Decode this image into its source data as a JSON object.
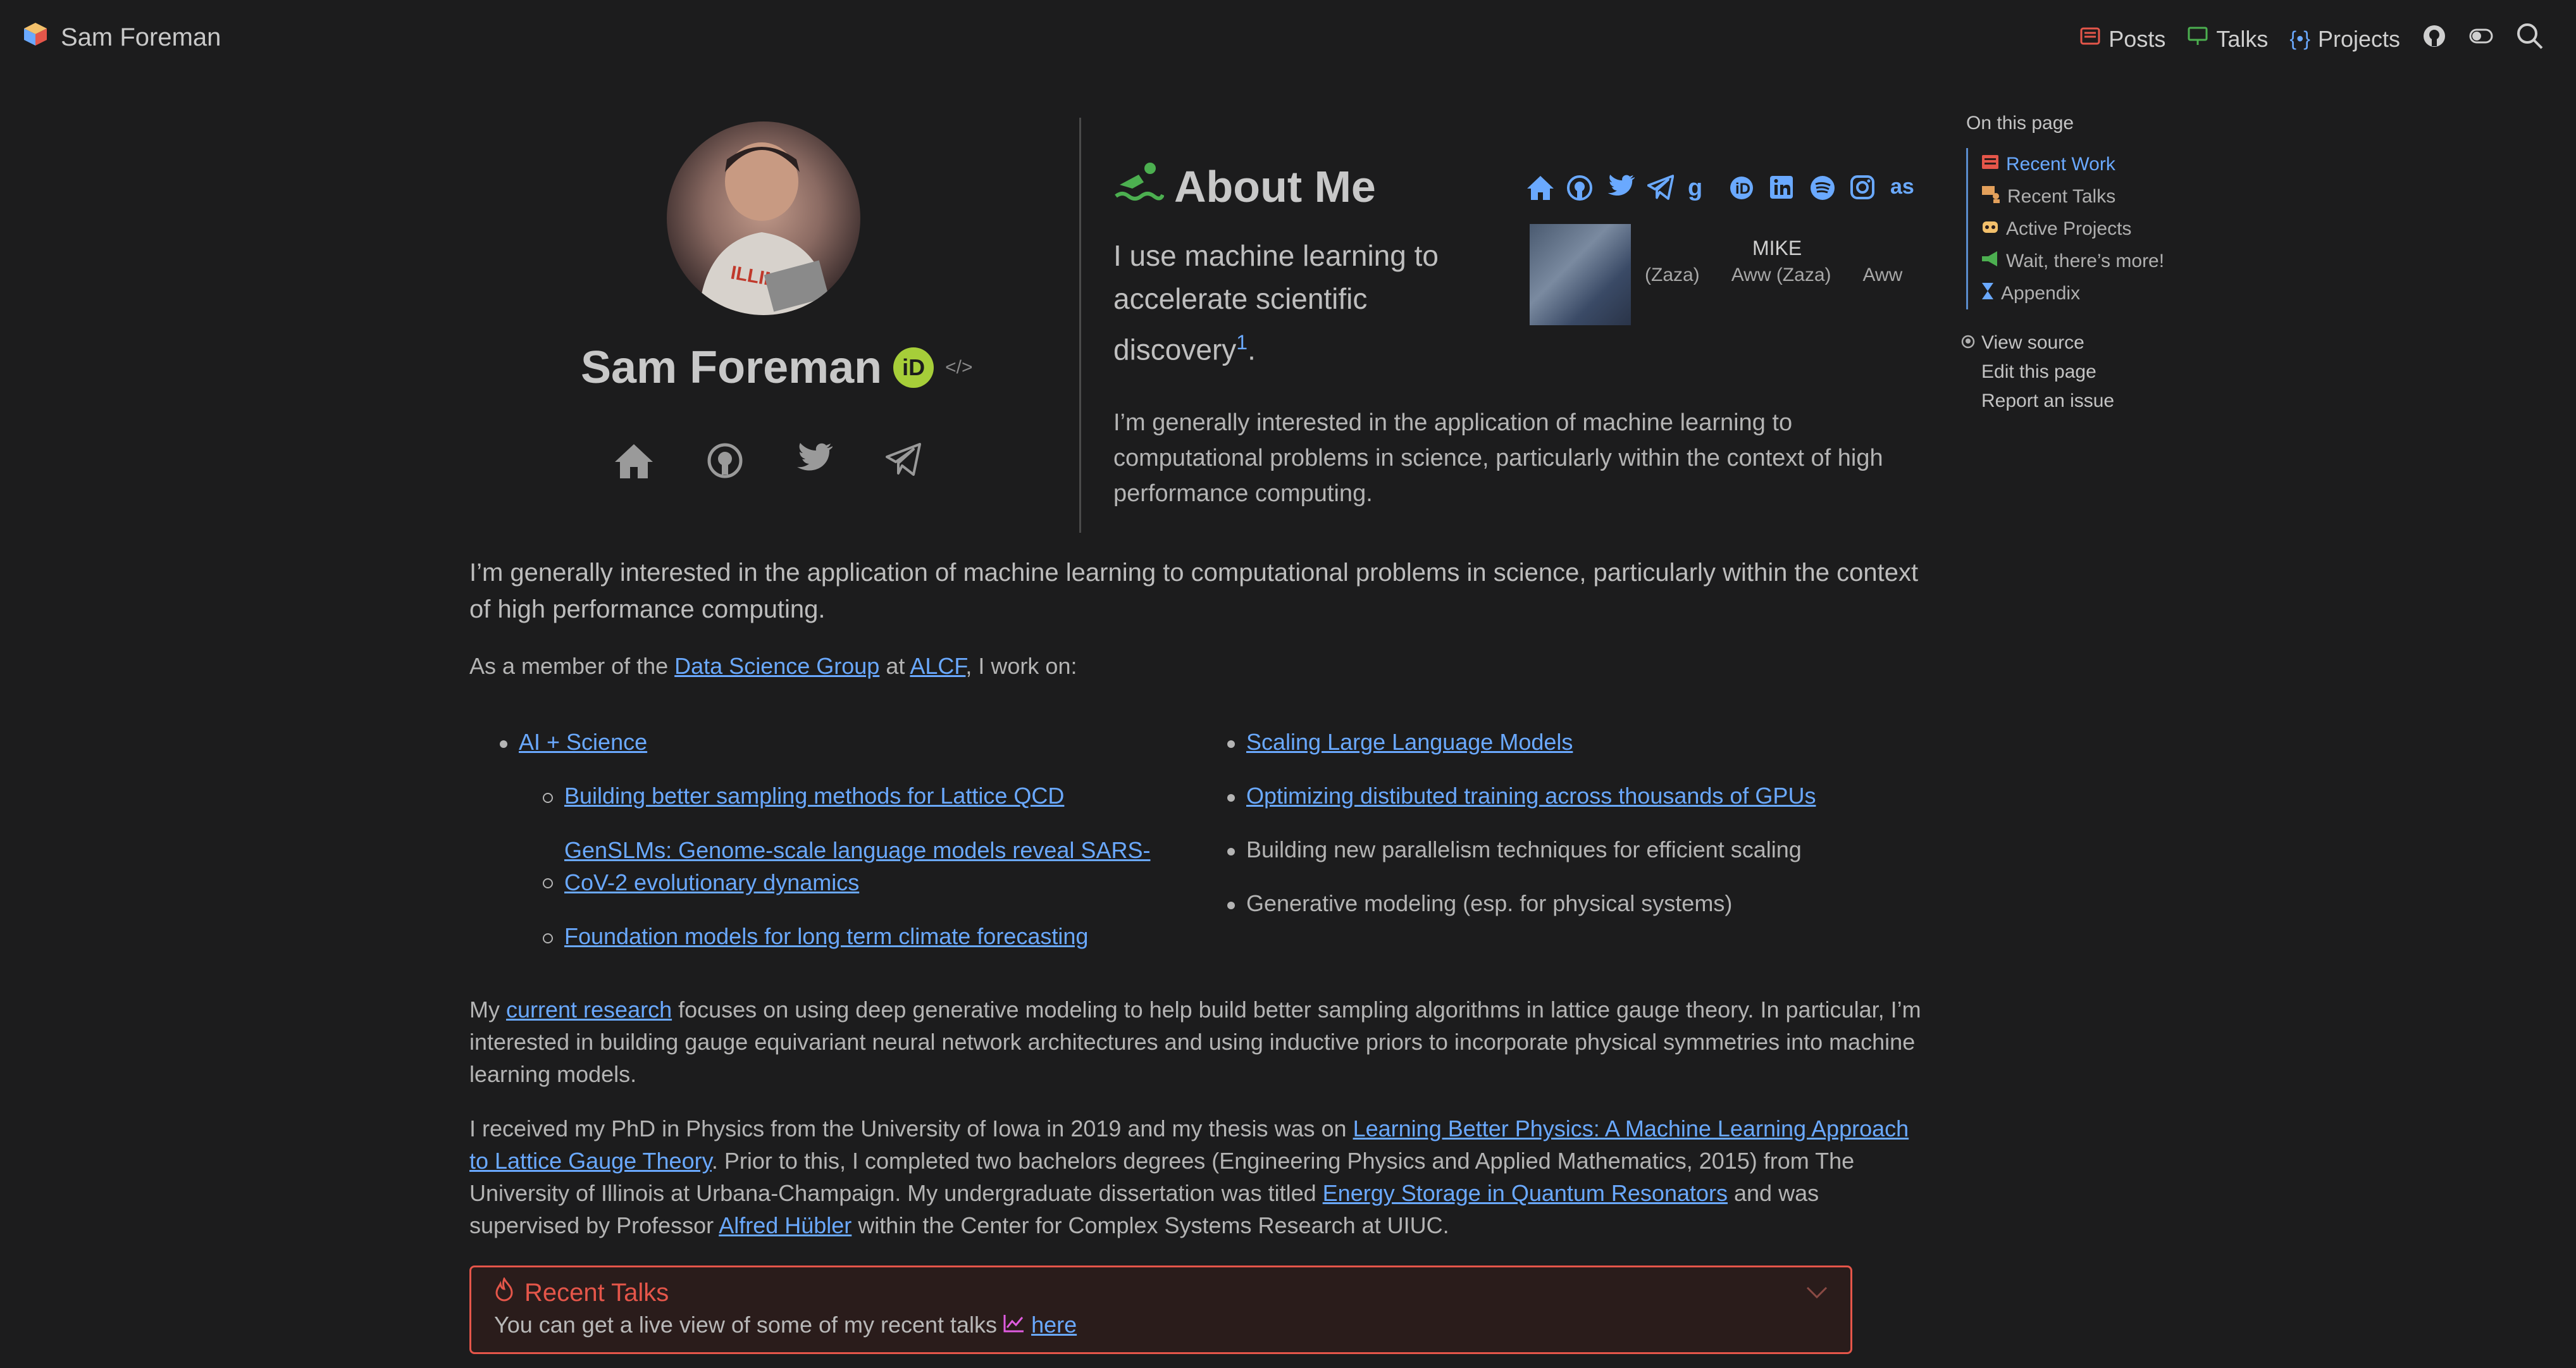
{
  "navbar": {
    "brand": "Sam Foreman",
    "links": [
      {
        "label": "Posts",
        "icon": "newspaper-icon",
        "color": "#e5564a"
      },
      {
        "label": "Talks",
        "icon": "presentation-icon",
        "color": "#4caf50"
      },
      {
        "label": "Projects",
        "icon": "code-braces-icon",
        "color": "#6aa9ff"
      }
    ]
  },
  "hero": {
    "name": "Sam Foreman",
    "orcid": "iD",
    "code_glyph": "</>"
  },
  "about": {
    "title": "About Me",
    "lead": "I use machine learning to accelerate scientific discovery",
    "footnote": "1",
    "lead_end": ".",
    "para": "I’m generally interested in the application of machine learning to computational problems in science, particularly within the context of high performance computing.",
    "mike": {
      "name": "MIKE",
      "captions": [
        "(Zaza)",
        "Aww (Zaza)",
        "Aww"
      ]
    }
  },
  "toc": {
    "title": "On this page",
    "items": [
      "Recent Work",
      "Recent Talks",
      "Active Projects",
      "Wait, there’s more!",
      "Appendix"
    ],
    "links": [
      "View source",
      "Edit this page",
      "Report an issue"
    ]
  },
  "content": {
    "lead": "I’m generally interested in the application of machine learning to computational problems in science, particularly within the context of high performance computing.",
    "member_pre": "As a member of the ",
    "member_link1": "Data Science Group",
    "member_mid": " at ",
    "member_link2": "ALCF",
    "member_post": ", I work on:",
    "col1_main": "AI + Science",
    "col1_sub": [
      "Building better sampling methods for Lattice QCD",
      "GenSLMs: Genome-scale language models reveal SARS-CoV-2 evolutionary dynamics",
      "Foundation models for long term climate forecasting"
    ],
    "col2": [
      "Scaling Large Language Models",
      "Optimizing distibuted training across thousands of GPUs",
      "Building new parallelism techniques for efficient scaling",
      "Generative modeling (esp. for physical systems)"
    ],
    "research_pre": "My ",
    "research_link": "current research",
    "research_post": " focuses on using deep generative modeling to help build better sampling algorithms in lattice gauge theory. In particular, I’m interested in building gauge equivariant neural network architectures and using inductive priors to incorporate physical symmetries into machine learning models.",
    "phd_1": "I received my PhD in Physics from the University of Iowa in 2019 and my thesis was on ",
    "phd_link1": "Learning Better Physics: A Machine Learning Approach to Lattice Gauge Theory",
    "phd_2": ". Prior to this, I completed two bachelors degrees (Engineering Physics and Applied Mathematics, 2015) from The University of Illinois at Urbana-Champaign. My undergraduate dissertation was titled ",
    "phd_link2": "Energy Storage in Quantum Resonators",
    "phd_3": " and was supervised by Professor ",
    "phd_link3": "Alfred Hübler",
    "phd_4": " within the Center for Complex Systems Research at UIUC."
  },
  "callout": {
    "title": "Recent Talks",
    "body": "You can get a live view of some of my recent talks ",
    "link": "here"
  }
}
